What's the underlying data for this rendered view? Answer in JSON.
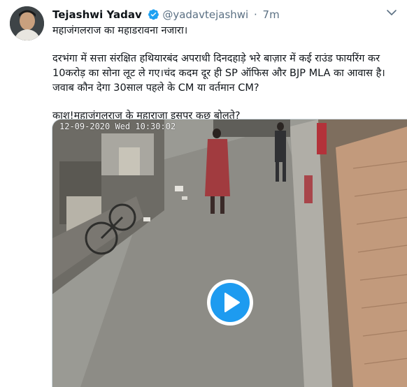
{
  "tweet": {
    "author_name": "Tejashwi Yadav",
    "handle": "@yadavtejashwi",
    "separator": "·",
    "time": "7m",
    "paragraphs": [
      "महाजंगलराज का महाडरावना नजारा।",
      "दरभंगा में सत्ता संरक्षित हथियारबंद अपराधी दिनदहाड़े भरे बाज़ार में कई राउंड फायरिंग कर 10करोड़ का सोना लूट ले गए।चंद कदम दूर ही SP ऑफिस और BJP MLA का आवास है। जवाब कौन देगा 30साल पहले के CM या वर्तमान CM?",
      "काश!महाजंगलराज के महाराजा इसपर कुछ बोलते?"
    ]
  },
  "media": {
    "overlay_timestamp": "12-09-2020 Wed 10:30:02"
  },
  "icons": {
    "verified": "verified-badge-icon",
    "more": "chevron-down-icon",
    "play": "play-icon"
  },
  "colors": {
    "verified_blue": "#1da1f2",
    "play_blue": "#1d9bf0",
    "secondary_text": "#5b7083"
  }
}
